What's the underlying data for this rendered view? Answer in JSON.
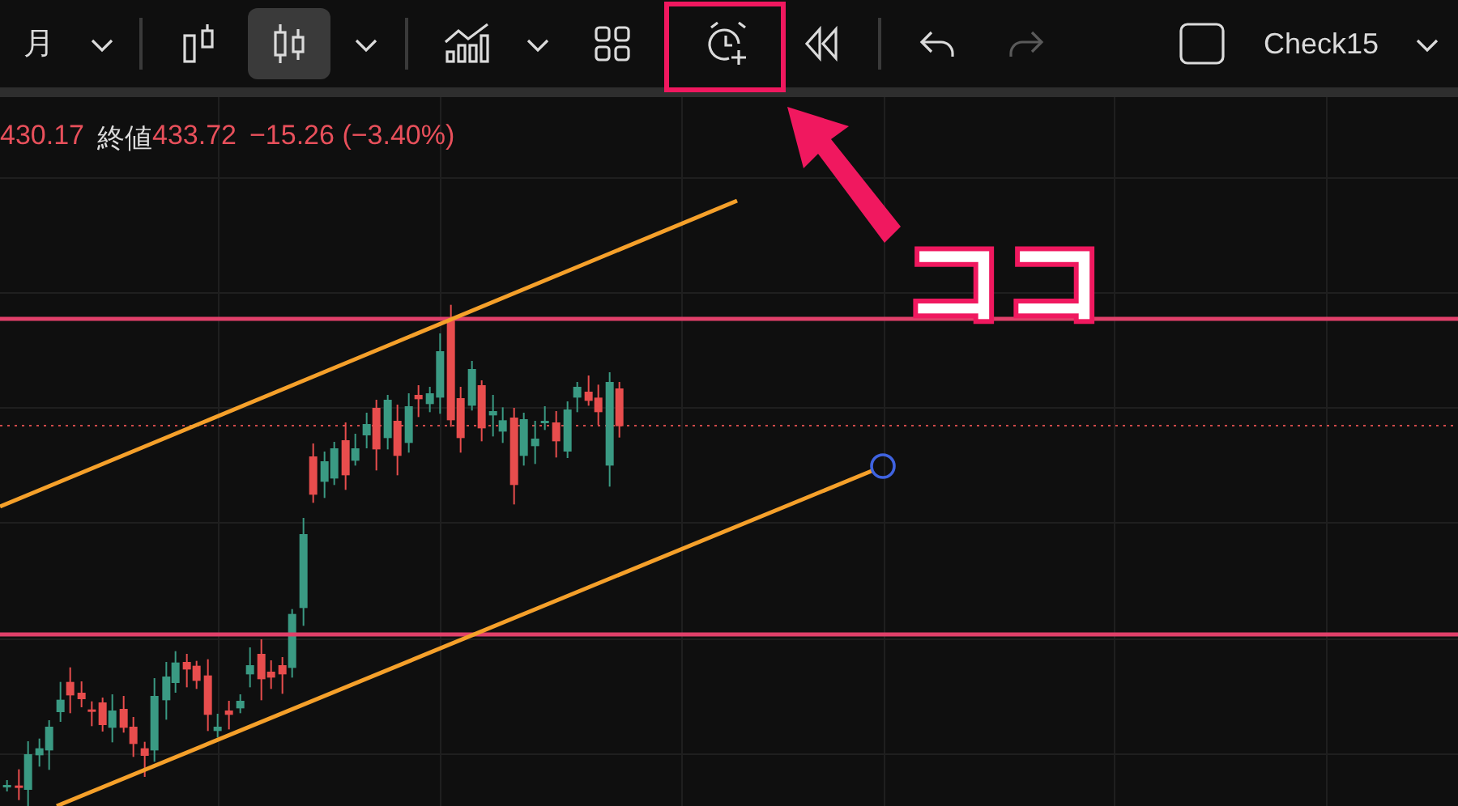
{
  "toolbar": {
    "interval": "月",
    "chart_types": [
      {
        "kind": "bars",
        "selected": false
      },
      {
        "kind": "candles",
        "selected": true
      }
    ],
    "history": [
      {
        "kind": "undo",
        "disabled": false
      },
      {
        "kind": "redo",
        "disabled": true
      }
    ],
    "layout_name": "Check15"
  },
  "legend": [
    {
      "kind": "value",
      "text": "430.17"
    },
    {
      "kind": "label",
      "text": "終値"
    },
    {
      "kind": "value",
      "text": "433.72"
    },
    {
      "kind": "value",
      "text": "−15.26 (−3.40%)"
    }
  ],
  "annotation": {
    "callout": "ココ"
  }
}
